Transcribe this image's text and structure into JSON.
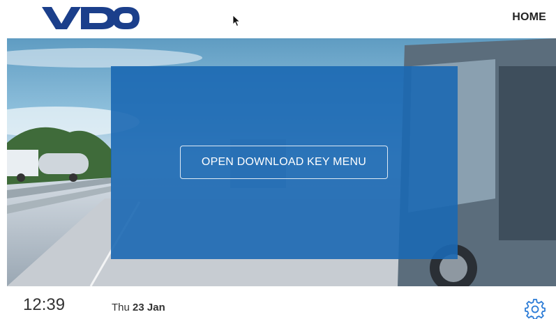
{
  "header": {
    "logo_text": "VDO",
    "home_label": "HOME"
  },
  "main": {
    "open_download_label": "OPEN DOWNLOAD KEY MENU"
  },
  "footer": {
    "time": "12:39",
    "weekday": "Thu",
    "date": "23 Jan"
  },
  "icons": {
    "settings": "gear-icon",
    "pointer": "mouse-cursor"
  },
  "colors": {
    "brand_blue": "#1b3f8b",
    "overlay_blue": "#1b68b2",
    "settings_icon": "#2b7bd6"
  }
}
